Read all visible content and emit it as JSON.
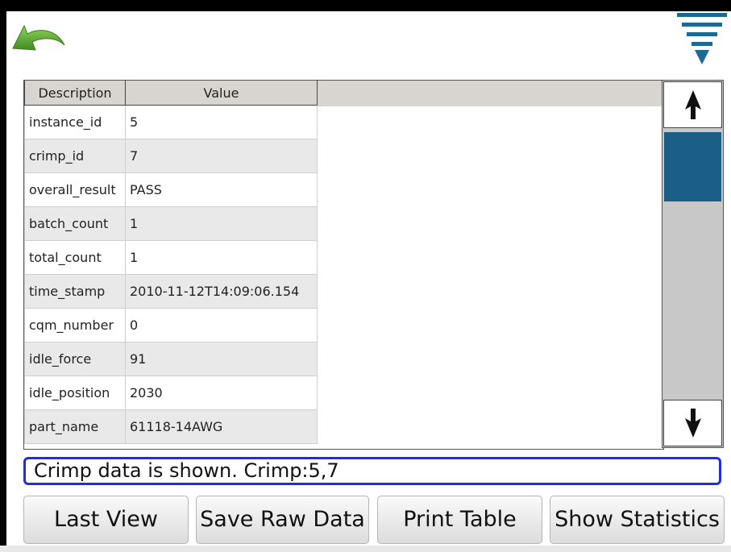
{
  "toolbar": {
    "back_icon": "back-arrow-icon",
    "menu_icon": "menu-triangle-icon"
  },
  "table": {
    "headers": [
      "Description",
      "Value"
    ],
    "rows": [
      {
        "description": "instance_id",
        "value": "5"
      },
      {
        "description": "crimp_id",
        "value": "7"
      },
      {
        "description": "overall_result",
        "value": "PASS"
      },
      {
        "description": "batch_count",
        "value": "1"
      },
      {
        "description": "total_count",
        "value": "1"
      },
      {
        "description": "time_stamp",
        "value": "2010-11-12T14:09:06.154"
      },
      {
        "description": "cqm_number",
        "value": "0"
      },
      {
        "description": "idle_force",
        "value": "91"
      },
      {
        "description": "idle_position",
        "value": "2030"
      },
      {
        "description": "part_name",
        "value": "61118-14AWG"
      }
    ]
  },
  "scrollbar": {
    "up_icon": "arrow-up-icon",
    "down_icon": "arrow-down-icon",
    "thumb_color": "#1b5f86"
  },
  "status": {
    "message": "Crimp data is shown. Crimp:5,7",
    "border_color": "#1f2fdc"
  },
  "buttons": {
    "last_view": "Last View",
    "save_raw_data": "Save Raw Data",
    "print_table": "Print Table",
    "show_statistics": "Show Statistics"
  },
  "colors": {
    "accent": "#1b6a96",
    "back_arrow": "#5aa832",
    "header_bg": "#d8d4d0"
  }
}
